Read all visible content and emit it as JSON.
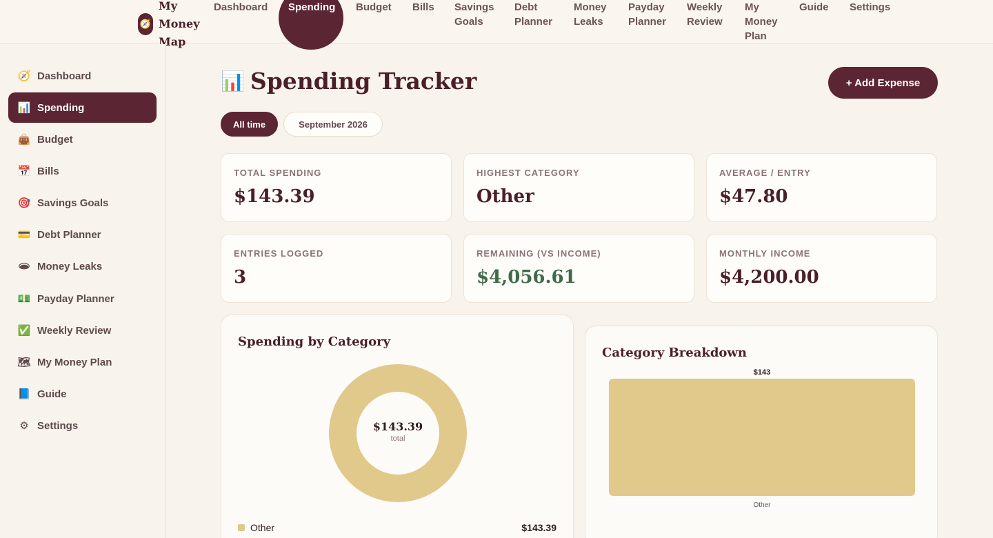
{
  "brand": {
    "name": "My Money Map",
    "logo_icon": "compass-icon"
  },
  "topnav": [
    {
      "label": "Dashboard"
    },
    {
      "label": "Spending",
      "active": true
    },
    {
      "label": "Budget"
    },
    {
      "label": "Bills"
    },
    {
      "label": "Savings Goals"
    },
    {
      "label": "Debt Planner"
    },
    {
      "label": "Money Leaks"
    },
    {
      "label": "Payday Planner"
    },
    {
      "label": "Weekly Review"
    },
    {
      "label": "My Money Plan"
    },
    {
      "label": "Guide"
    },
    {
      "label": "Settings"
    }
  ],
  "sidebar": {
    "items": [
      {
        "label": "Dashboard",
        "icon": "🧭"
      },
      {
        "label": "Spending",
        "icon": "📊",
        "active": true
      },
      {
        "label": "Budget",
        "icon": "👜"
      },
      {
        "label": "Bills",
        "icon": "📅"
      },
      {
        "label": "Savings Goals",
        "icon": "🎯"
      },
      {
        "label": "Debt Planner",
        "icon": "💳"
      },
      {
        "label": "Money Leaks",
        "icon": "🕳"
      },
      {
        "label": "Payday Planner",
        "icon": "💵"
      },
      {
        "label": "Weekly Review",
        "icon": "✅"
      },
      {
        "label": "My Money Plan",
        "icon": "🗺"
      },
      {
        "label": "Guide",
        "icon": "📘"
      },
      {
        "label": "Settings",
        "icon": "⚙"
      }
    ]
  },
  "main": {
    "title": "Spending Tracker",
    "title_icon": "📊",
    "add_button": "+ Add Expense",
    "filters": [
      {
        "label": "All time",
        "active": true
      },
      {
        "label": "September 2026"
      }
    ],
    "stats": [
      {
        "label": "TOTAL SPENDING",
        "value": "$143.39"
      },
      {
        "label": "HIGHEST CATEGORY",
        "value": "Other"
      },
      {
        "label": "AVERAGE / ENTRY",
        "value": "$47.80"
      },
      {
        "label": "ENTRIES LOGGED",
        "value": "3"
      },
      {
        "label": "REMAINING (VS INCOME)",
        "value": "$4,056.61",
        "positive": true
      },
      {
        "label": "MONTHLY INCOME",
        "value": "$4,200.00"
      }
    ]
  },
  "colors": {
    "accent": "#5c2533",
    "category_other": "#e0c98a",
    "positive": "#3f6b4a"
  },
  "chart_data": [
    {
      "type": "pie",
      "title": "Spending by Category",
      "center_value": "$143.39",
      "center_label": "total",
      "categories": [
        "Other"
      ],
      "values": [
        143.39
      ],
      "value_labels": [
        "$143.39"
      ]
    },
    {
      "type": "bar",
      "title": "Category Breakdown",
      "categories": [
        "Other"
      ],
      "values": [
        143.39
      ],
      "value_labels": [
        "$143"
      ],
      "ylim": [
        0,
        143.39
      ]
    }
  ]
}
